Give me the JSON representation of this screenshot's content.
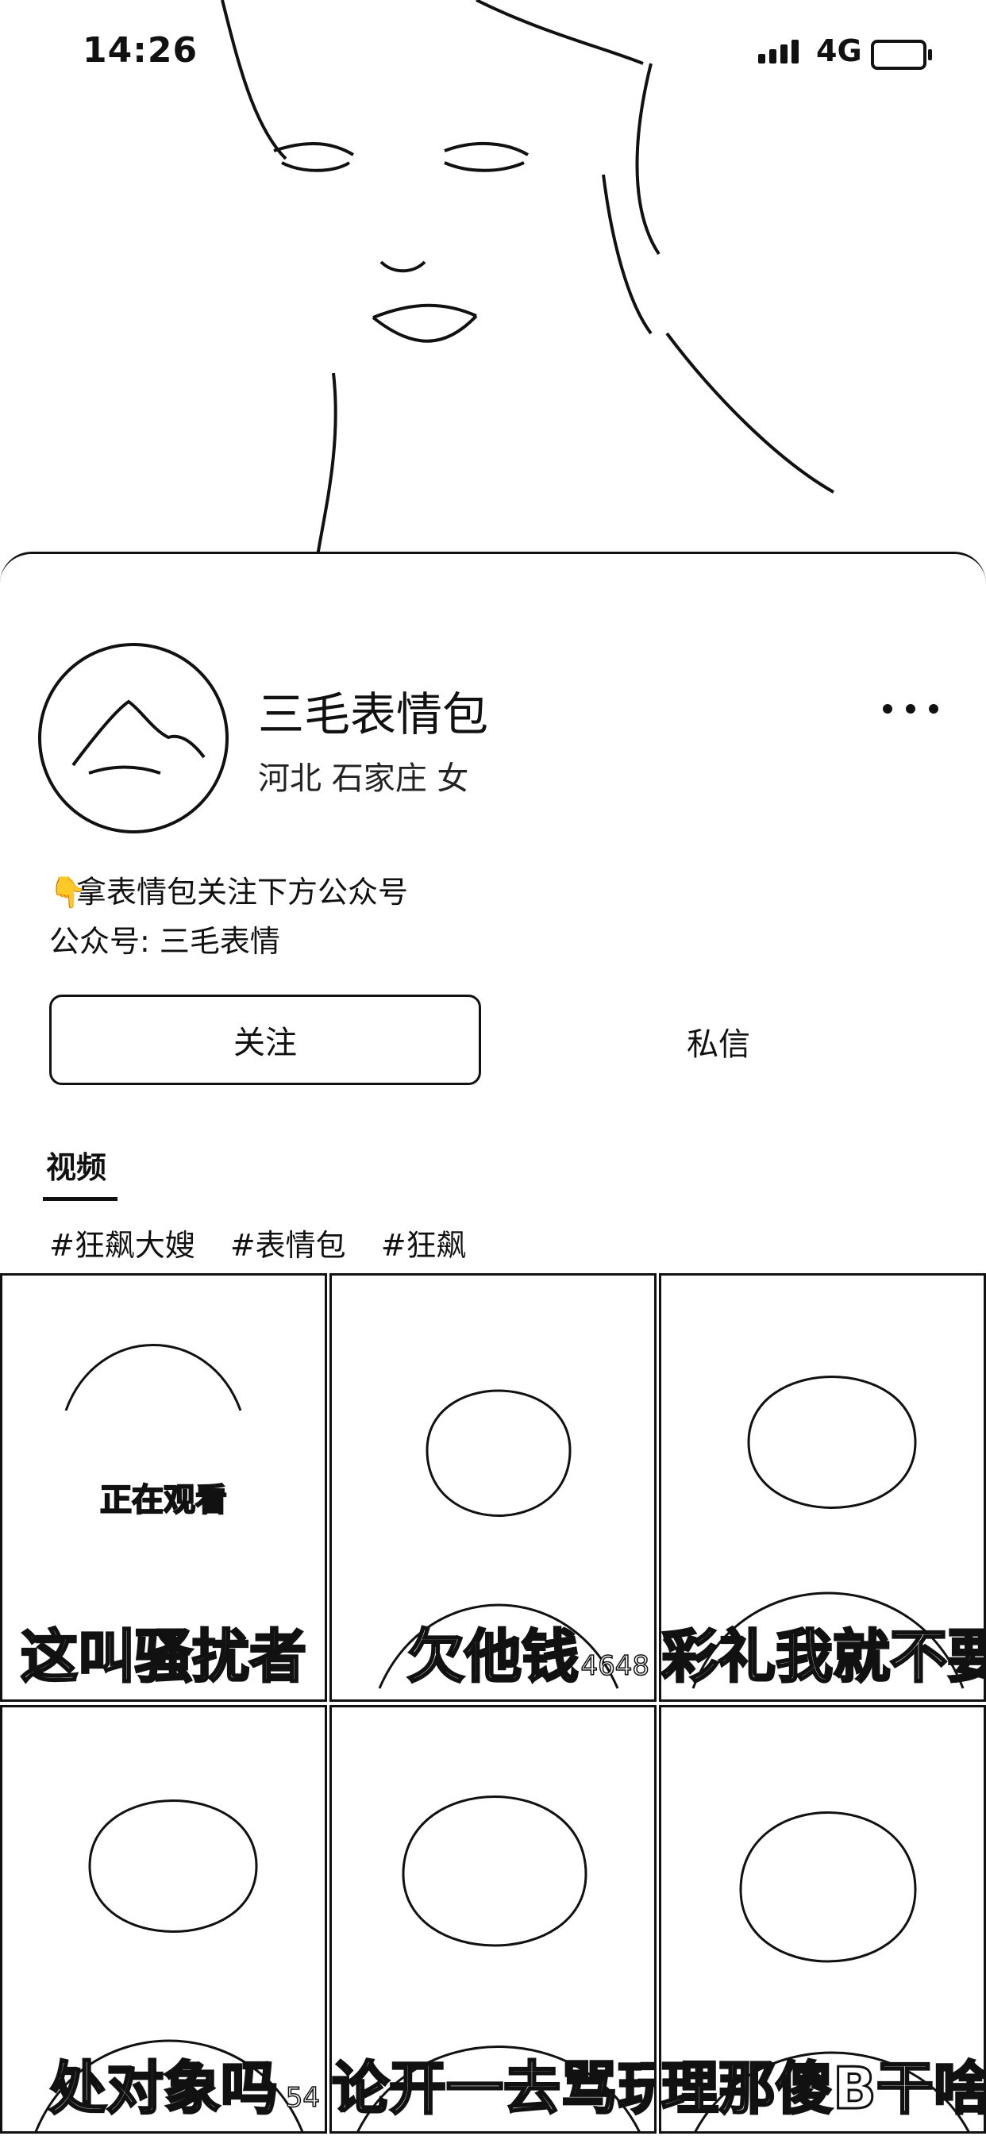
{
  "status_bar": {
    "time": "14:26",
    "network": "4G"
  },
  "profile": {
    "name": "三毛表情包",
    "location": "河北 石家庄 女",
    "bio_line1": "拿表情包关注下方公众号",
    "bio_line2": "公众号: 三毛表情"
  },
  "actions": {
    "follow_label": "关注",
    "message_label": "私信"
  },
  "tabs": {
    "videos_label": "视频"
  },
  "tags": [
    "#狂飙大嫂",
    "#表情包",
    "#狂飙"
  ],
  "videos": [
    {
      "caption": "这叫骚扰者",
      "views": "",
      "overlay": "正在观看"
    },
    {
      "caption": "欠他钱",
      "views": "4648",
      "overlay": ""
    },
    {
      "caption": "彩礼我就不要了",
      "views": "",
      "overlay": ""
    },
    {
      "caption": "处对象吗",
      "views": "54",
      "overlay": ""
    },
    {
      "caption": "论开一去骂玩",
      "views": "",
      "overlay": ""
    },
    {
      "caption": "理那傻B干啥",
      "views": "",
      "overlay": ""
    }
  ]
}
